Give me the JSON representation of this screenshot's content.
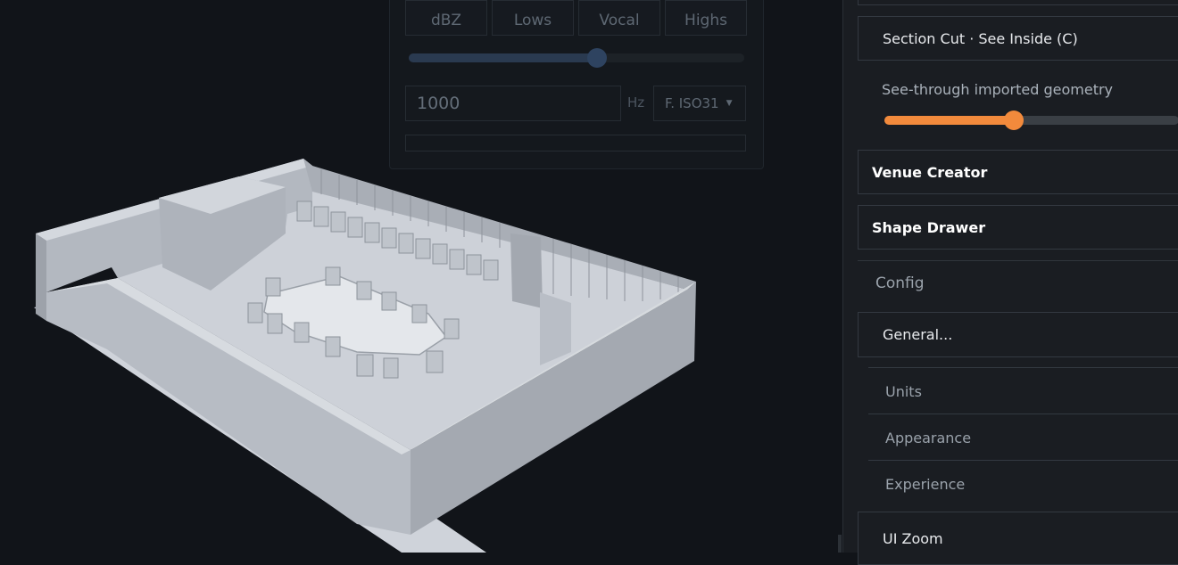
{
  "band_panel": {
    "buttons": [
      "dBZ",
      "Lows",
      "Vocal",
      "Highs"
    ],
    "frequency_slider": 0.56,
    "frequency_value": "1000",
    "frequency_unit": "Hz",
    "filter_selected": "F. ISO31"
  },
  "side_panel": {
    "section_cut_label": "Section Cut · See Inside (C)",
    "see_through_label": "See-through imported geometry",
    "see_through_value": 0.44,
    "venue_creator": "Venue Creator",
    "shape_drawer": "Shape Drawer",
    "config_label": "Config",
    "general_label": "General...",
    "sub_items": [
      "Units",
      "Appearance",
      "Experience"
    ],
    "ui_zoom_label": "UI Zoom"
  },
  "colors": {
    "accent": "#f28a3c",
    "background": "#111419",
    "panel": "#1a1d22",
    "model": "#c3c8d0"
  },
  "icons": [
    "chevron-down-icon"
  ]
}
